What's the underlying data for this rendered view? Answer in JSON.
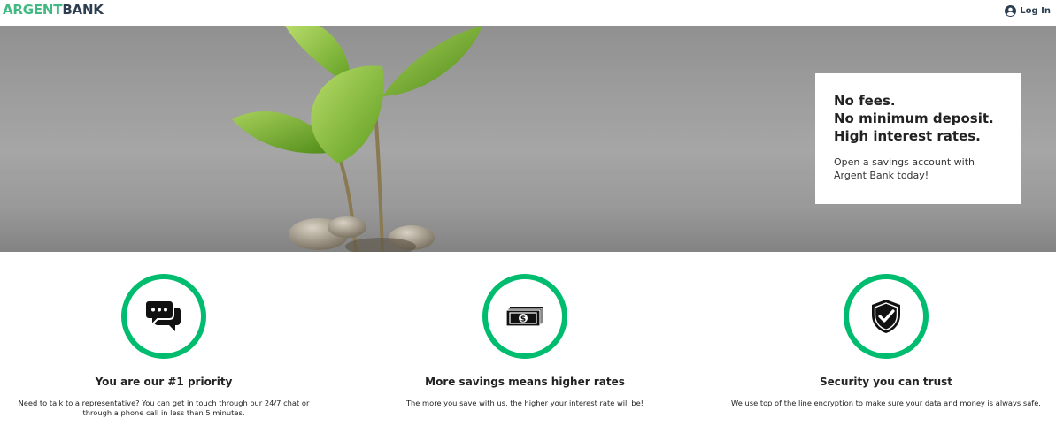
{
  "header": {
    "logo_part1": "ARGENT",
    "logo_part2": "BANK",
    "login_label": "Log In",
    "login_icon": "user-circle-icon"
  },
  "hero": {
    "headline_line1": "No fees.",
    "headline_line2": "No minimum deposit.",
    "headline_line3": "High interest rates.",
    "subtext": "Open a savings account with Argent Bank today!",
    "image": "plant-growing-from-coins"
  },
  "features": [
    {
      "icon": "chat-icon",
      "title": "You are our #1 priority",
      "text": "Need to talk to a representative? You can get in touch through our 24/7 chat or through a phone call in less than 5 minutes."
    },
    {
      "icon": "money-icon",
      "title": "More savings means higher rates",
      "text": "The more you save with us, the higher your interest rate will be!"
    },
    {
      "icon": "security-shield-icon",
      "title": "Security you can trust",
      "text": "We use top of the line encryption to make sure your data and money is always safe."
    }
  ],
  "colors": {
    "brand_green": "#42b983",
    "circle_green": "#00bc6e",
    "dark_text": "#2c3e50"
  }
}
